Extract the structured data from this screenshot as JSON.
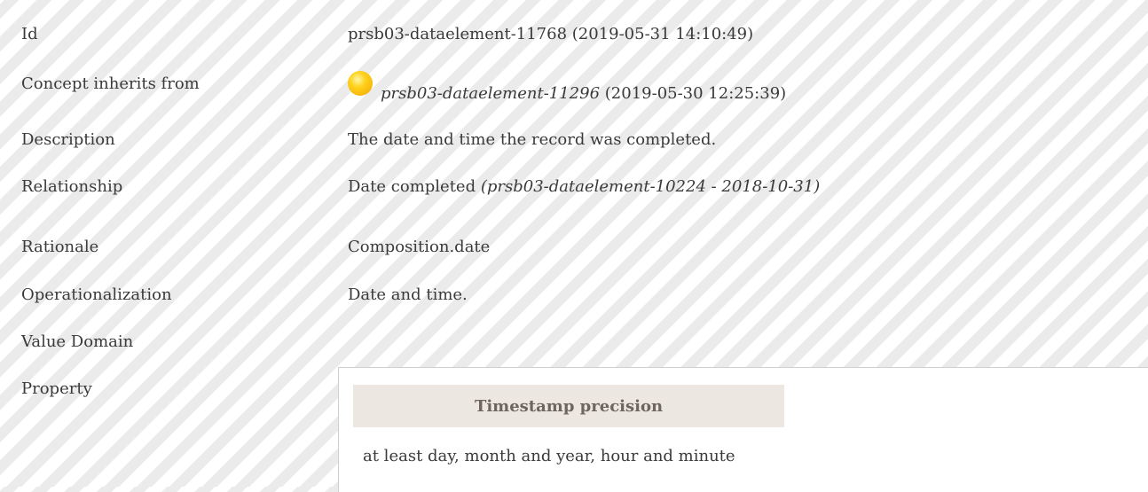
{
  "rows": {
    "id": {
      "label": "Id",
      "value": "prsb03-dataelement-11768 (2019-05-31 14:10:49)"
    },
    "inherits": {
      "label": "Concept inherits from",
      "link": "prsb03-dataelement-11296",
      "date": "(2019-05-30 12:25:39)",
      "status_icon": "yellow-circle-icon",
      "status_color": "#ffd21c"
    },
    "description": {
      "label": "Description",
      "value": "The date and time the record was completed."
    },
    "relationship": {
      "label": "Relationship",
      "value": "Date completed",
      "ref": "(prsb03-dataelement-10224 - 2018-10-31)"
    },
    "rationale": {
      "label": "Rationale",
      "value": "Composition.date"
    },
    "operationalization": {
      "label": "Operationalization",
      "value": "Date and time."
    },
    "value_domain": {
      "label": "Value Domain"
    },
    "property": {
      "label": "Property",
      "header": "Timestamp precision",
      "text": "at least day, month and year, hour and minute"
    }
  }
}
